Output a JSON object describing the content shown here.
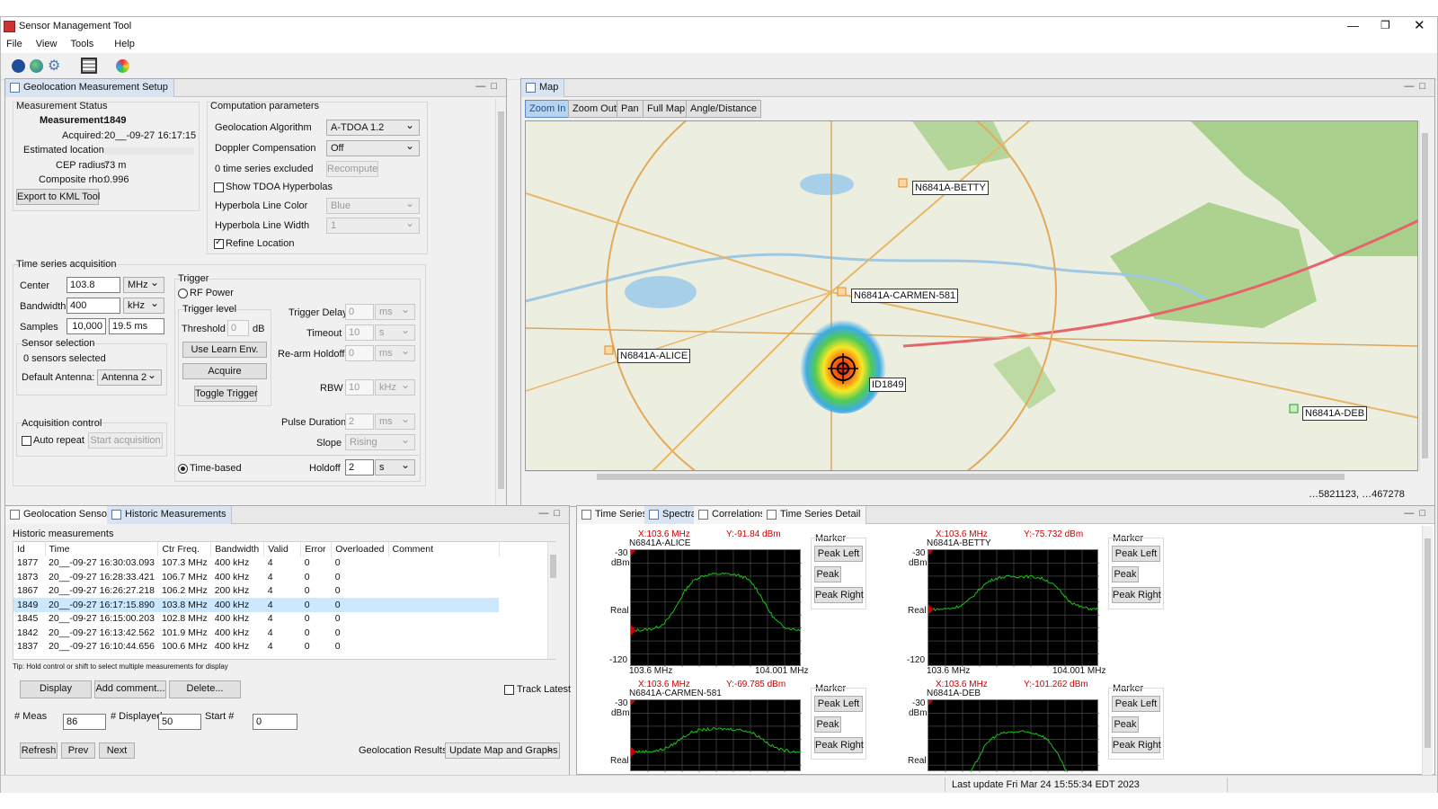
{
  "app": {
    "title": "Sensor Management Tool"
  },
  "menu": [
    "File",
    "View",
    "Tools",
    "Help"
  ],
  "colors": {
    "accent": "#3b6cb7",
    "trace": "#19c219",
    "marker": "#cc0000",
    "selected_row": "#cce8ff"
  },
  "setup": {
    "tab": "Geolocation Measurement Setup",
    "status_title": "Measurement Status",
    "measurement_label": "Measurement:",
    "measurement": "1849",
    "acquired_label": "Acquired:",
    "acquired": "20__-09-27 16:17:15",
    "est_loc_label": "Estimated location:",
    "cep_label": "CEP radius:",
    "cep": "73 m",
    "rho_label": "Composite rho:",
    "rho": "0.996",
    "export_btn": "Export to KML Tool",
    "comp_title": "Computation parameters",
    "algo_label": "Geolocation Algorithm",
    "algo": "A-TDOA 1.2",
    "doppler_label": "Doppler Compensation",
    "doppler": "Off",
    "excluded": "0 time series excluded",
    "recompute_btn": "Recompute",
    "show_hyper": "Show TDOA Hyperbolas",
    "hyper_color_label": "Hyperbola Line Color",
    "hyper_color": "Blue",
    "hyper_width_label": "Hyperbola Line Width",
    "hyper_width": "1",
    "refine": "Refine Location",
    "ts_title": "Time series acquisition",
    "center_label": "Center",
    "center": "103.8",
    "center_unit": "MHz",
    "bw_label": "Bandwidth",
    "bw": "400",
    "bw_unit": "kHz",
    "samples_label": "Samples",
    "samples": "10,000",
    "samples_time": "19.5 ms",
    "sensor_sel_title": "Sensor selection",
    "sensors_selected": "0 sensors selected",
    "default_ant_label": "Default Antenna:",
    "default_ant": "Antenna 2",
    "acq_title": "Acquisition control",
    "auto_repeat": "Auto repeat",
    "start_btn": "Start acquisition",
    "trigger_title": "Trigger",
    "rf_power": "RF Power",
    "trigger_level": "Trigger level",
    "threshold_label": "Threshold",
    "threshold": "0",
    "threshold_unit": "dB",
    "learn_btn": "Use Learn Env.",
    "acquire_btn": "Acquire",
    "toggle_btn": "Toggle Trigger",
    "trig_delay_label": "Trigger Delay",
    "trig_delay": "0",
    "trig_delay_unit": "ms",
    "timeout_label": "Timeout",
    "timeout": "10",
    "timeout_unit": "s",
    "rearm_label": "Re-arm Holdoff",
    "rearm": "0",
    "rearm_unit": "ms",
    "rbw_label": "RBW",
    "rbw": "10",
    "rbw_unit": "kHz",
    "pulse_label": "Pulse Duration",
    "pulse": "2",
    "pulse_unit": "ms",
    "slope_label": "Slope",
    "slope": "Rising",
    "time_based": "Time-based",
    "holdoff_label": "Holdoff",
    "holdoff": "2",
    "holdoff_unit": "s"
  },
  "map": {
    "tab": "Map",
    "tools": [
      "Zoom In",
      "Zoom Out",
      "Pan",
      "Full Map",
      "Angle/Distance"
    ],
    "labels": {
      "betty": "N6841A-BETTY",
      "carmen": "N6841A-CARMEN-581",
      "alice": "N6841A-ALICE",
      "deb": "N6841A-DEB",
      "id": "ID1849"
    },
    "coords": "…5821123, …467278"
  },
  "hist": {
    "tabs": [
      "Geolocation Sensors",
      "Historic Measurements"
    ],
    "title": "Historic measurements",
    "columns": [
      "Id",
      "Time",
      "Ctr Freq.",
      "Bandwidth",
      "Valid",
      "Error",
      "Overloaded",
      "Comment"
    ],
    "rows": [
      [
        "1877",
        "20__-09-27 16:30:03.093",
        "107.3 MHz",
        "400 kHz",
        "4",
        "0",
        "0",
        ""
      ],
      [
        "1873",
        "20__-09-27 16:28:33.421",
        "106.7 MHz",
        "400 kHz",
        "4",
        "0",
        "0",
        ""
      ],
      [
        "1867",
        "20__-09-27 16:26:27.218",
        "106.2 MHz",
        "200 kHz",
        "4",
        "0",
        "0",
        ""
      ],
      [
        "1849",
        "20__-09-27 16:17:15.890",
        "103.8 MHz",
        "400 kHz",
        "4",
        "0",
        "0",
        ""
      ],
      [
        "1845",
        "20__-09-27 16:15:00.203",
        "102.8 MHz",
        "400 kHz",
        "4",
        "0",
        "0",
        ""
      ],
      [
        "1842",
        "20__-09-27 16:13:42.562",
        "101.9 MHz",
        "400 kHz",
        "4",
        "0",
        "0",
        ""
      ],
      [
        "1837",
        "20__-09-27 16:10:44.656",
        "100.6 MHz",
        "400 kHz",
        "4",
        "0",
        "0",
        ""
      ]
    ],
    "tip": "Tip: Hold control or shift to select multiple measurements for display",
    "display_btn": "Display",
    "comment_btn": "Add comment...",
    "delete_btn": "Delete...",
    "track_latest": "Track Latest",
    "meas_label": "# Meas",
    "meas": "86",
    "displayed_label": "# Displayed",
    "displayed": "50",
    "start_label": "Start #",
    "start": "0",
    "refresh_btn": "Refresh",
    "prev_btn": "Prev",
    "next_btn": "Next",
    "results_label": "Geolocation Results",
    "results": "Update Map and Graphs"
  },
  "spectra": {
    "tabs": [
      "Time Series",
      "Spectra",
      "Correlations",
      "Time Series Detail"
    ],
    "marker_title": "Marker",
    "peak_left": "Peak Left",
    "peak": "Peak",
    "peak_right": "Peak Right",
    "ytop": "-30",
    "yunit": "dBm",
    "ymid": "Real",
    "ybot": "-120",
    "xleft": "103.6 MHz",
    "xright": "104.001 MHz",
    "plots": [
      {
        "name": "N6841A-ALICE",
        "mx": "X:103.6 MHz",
        "my": "Y:-91.84 dBm",
        "level": -91.84
      },
      {
        "name": "N6841A-BETTY",
        "mx": "X:103.6 MHz",
        "my": "Y:-75.732 dBm",
        "level": -75.732
      },
      {
        "name": "N6841A-CARMEN-581",
        "mx": "X:103.6 MHz",
        "my": "Y:-69.785 dBm",
        "level": -69.785
      },
      {
        "name": "N6841A-DEB",
        "mx": "X:103.6 MHz",
        "my": "Y:-101.262 dBm",
        "level": -101.262
      }
    ]
  },
  "status": {
    "last_update": "Last update Fri Mar 24 15:55:34 EDT 2023"
  }
}
